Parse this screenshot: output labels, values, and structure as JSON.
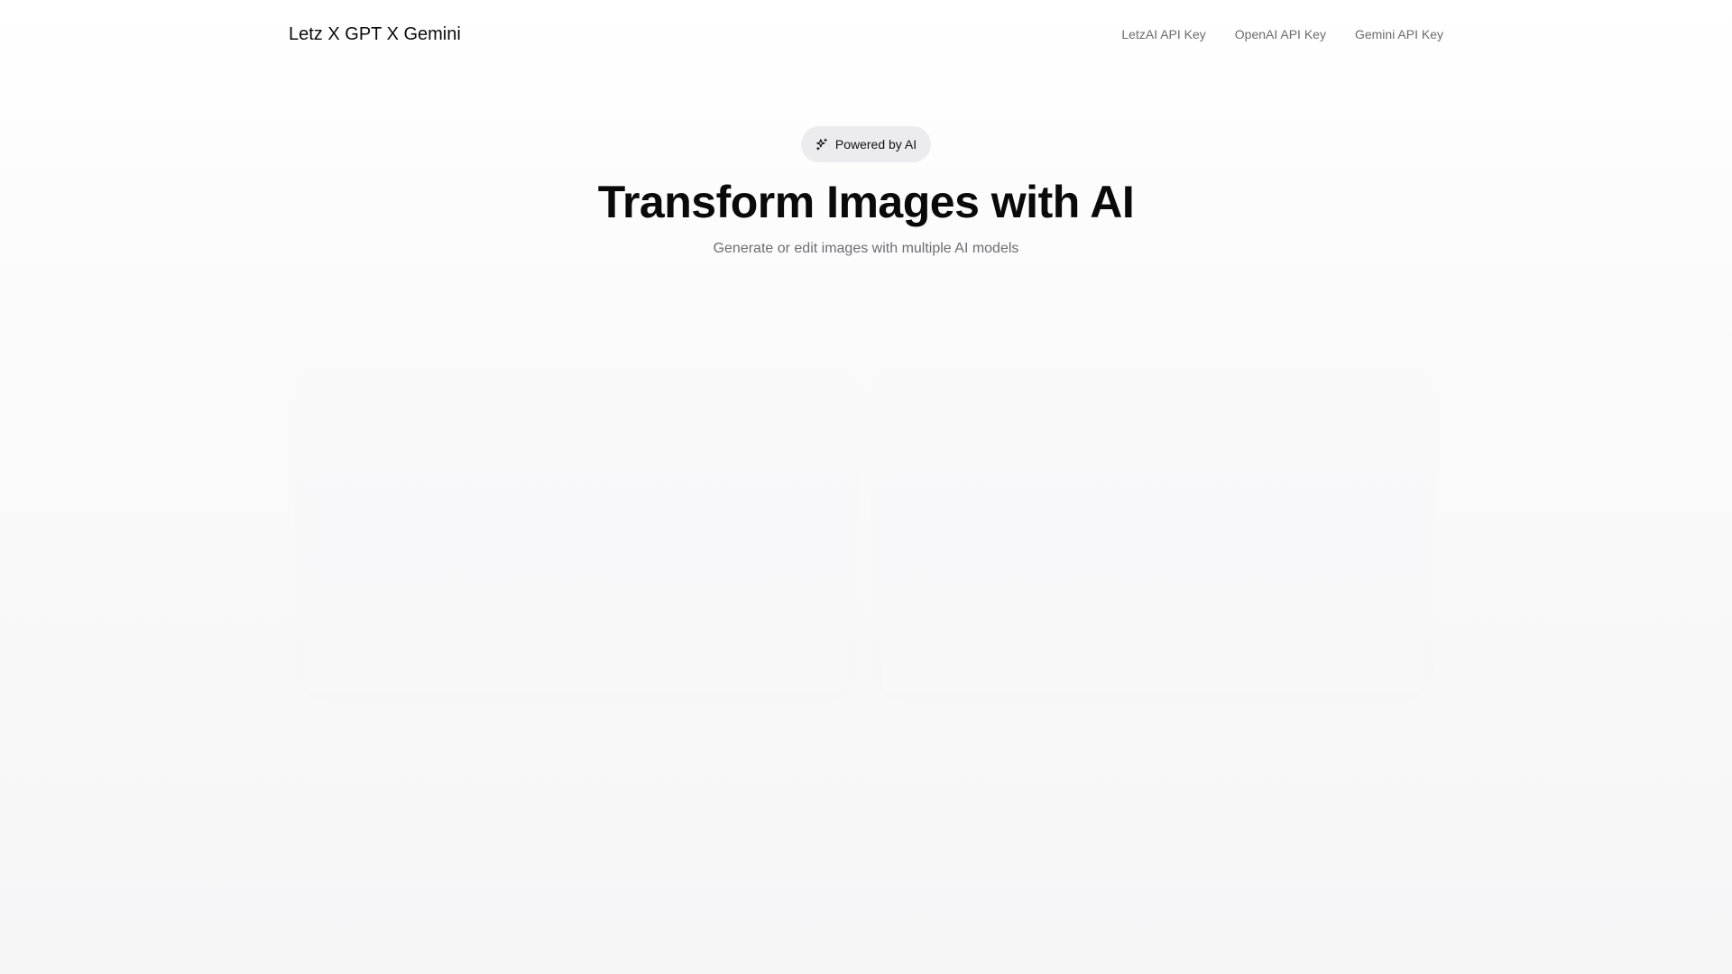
{
  "header": {
    "brand": "Letz X GPT X Gemini",
    "nav": [
      {
        "label": "LetzAI API Key"
      },
      {
        "label": "OpenAI API Key"
      },
      {
        "label": "Gemini API Key"
      }
    ]
  },
  "hero": {
    "badge": {
      "icon": "sparkles-icon",
      "label": "Powered by AI"
    },
    "title": "Transform Images with AI",
    "subtitle": "Generate or edit images with multiple AI models"
  },
  "colors": {
    "text": "#0a0a0a",
    "muted": "#6e6e73",
    "badge_bg": "#ececee",
    "background": "#f8f8f9"
  }
}
